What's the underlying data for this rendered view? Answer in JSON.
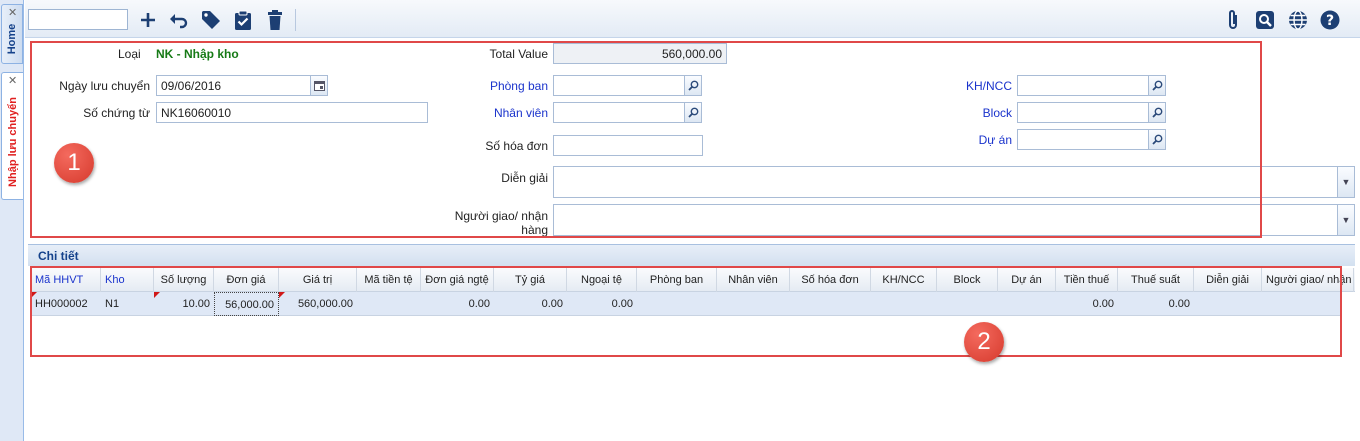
{
  "tabs": {
    "home": "Home",
    "current": "Nhập lưu chuyển"
  },
  "form": {
    "loai_label": "Loại",
    "loai_value": "NK - Nhập kho",
    "ngay_label": "Ngày lưu chuyển",
    "ngay_value": "09/06/2016",
    "so_chung_tu_label": "Số chứng từ",
    "so_chung_tu_value": "NK16060010",
    "total_label": "Total Value",
    "total_value": "560,000.00",
    "phong_ban_label": "Phòng ban",
    "phong_ban_value": "",
    "nhan_vien_label": "Nhân viên",
    "nhan_vien_value": "",
    "so_hoa_don_label": "Số hóa đơn",
    "so_hoa_don_value": "",
    "dien_giai_label": "Diễn giải",
    "dien_giai_value": "",
    "nguoi_giao_label_1": "Người giao/ nhận",
    "nguoi_giao_label_2": "hàng",
    "nguoi_giao_value": "",
    "khncc_label": "KH/NCC",
    "khncc_value": "",
    "block_label": "Block",
    "block_value": "",
    "du_an_label": "Dự án",
    "du_an_value": ""
  },
  "markers": {
    "one": "1",
    "two": "2"
  },
  "detail": {
    "section_title": "Chi tiết",
    "columns": [
      "Mã HHVT",
      "Kho",
      "Số lượng",
      "Đơn giá",
      "Giá trị",
      "Mã tiền tệ",
      "Đơn giá ngtệ",
      "Tỷ giá",
      "Ngoại tệ",
      "Phòng ban",
      "Nhân viên",
      "Số hóa đơn",
      "KH/NCC",
      "Block",
      "Dự án",
      "Tiền thuế",
      "Thuế suất",
      "Diễn giải",
      "Người giao/ nhận"
    ],
    "rows": [
      [
        "HH000002",
        "N1",
        "10.00",
        "56,000.00",
        "560,000.00",
        "",
        "0.00",
        "0.00",
        "0.00",
        "",
        "",
        "",
        "",
        "",
        "",
        "0.00",
        "0.00",
        "",
        ""
      ]
    ]
  },
  "colors": {
    "link": "#1a33cc",
    "accent_green": "#167a16",
    "highlight_red": "#e04848"
  }
}
